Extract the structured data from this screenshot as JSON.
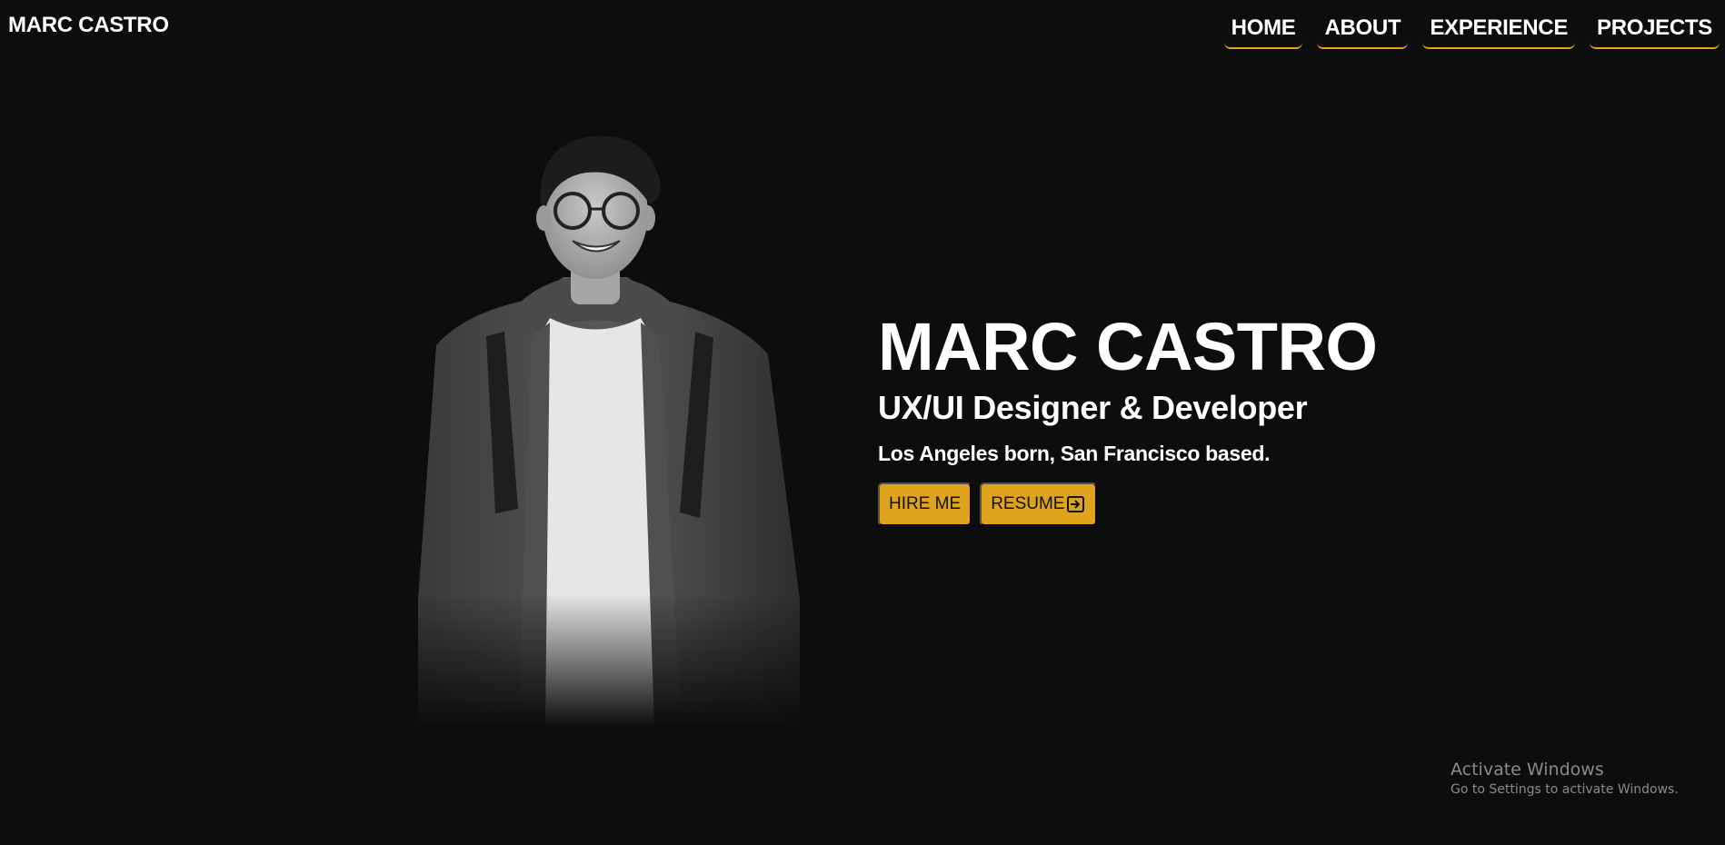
{
  "header": {
    "logo": "MARC CASTRO",
    "nav": [
      {
        "label": "HOME"
      },
      {
        "label": "ABOUT"
      },
      {
        "label": "EXPERIENCE"
      },
      {
        "label": "PROJECTS"
      }
    ]
  },
  "hero": {
    "name": "MARC CASTRO",
    "role": "UX/UI Designer & Developer",
    "location": "Los Angeles born, San Francisco based.",
    "hire_label": "HIRE ME",
    "resume_label": "RESUME",
    "resume_icon": "external-link-icon"
  },
  "overlay": {
    "title": "Activate Windows",
    "subtitle": "Go to Settings to activate Windows."
  },
  "colors": {
    "background": "#0d0d0d",
    "accent": "#e0a31c",
    "text": "#ffffff"
  }
}
